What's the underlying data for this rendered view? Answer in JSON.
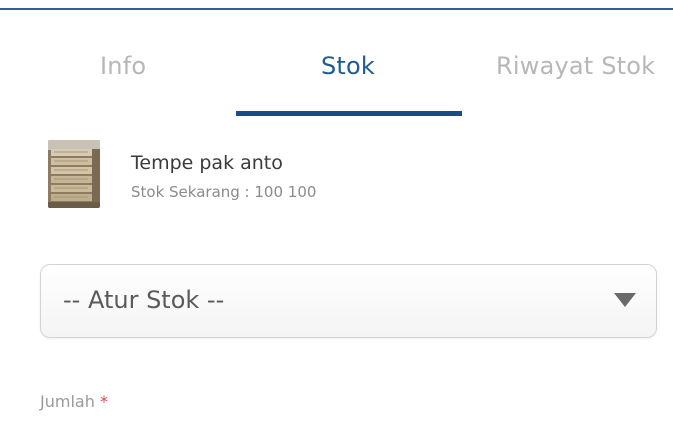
{
  "tabs": [
    {
      "label": "Info",
      "active": false
    },
    {
      "label": "Stok",
      "active": true
    },
    {
      "label": "Riwayat Stok",
      "active": false
    }
  ],
  "product": {
    "name": "Tempe pak anto",
    "stock_line": "Stok Sekarang : 100 100",
    "thumbnail_icon": "product-photo"
  },
  "stock_select": {
    "selected": "-- Atur Stok --",
    "caret_icon": "caret-down-icon"
  },
  "quantity_field": {
    "label": "Jumlah",
    "required_mark": "*"
  },
  "colors": {
    "accent": "#154f8a",
    "active_tab_text": "#1f5b93",
    "inactive_tab_text": "#b7b7b7",
    "required": "#e0474c"
  }
}
